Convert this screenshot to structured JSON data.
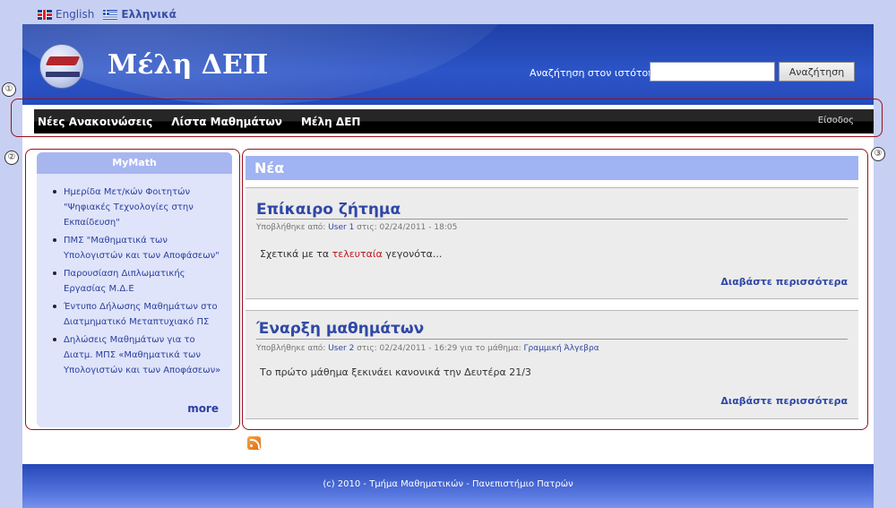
{
  "languages": [
    {
      "label": "English"
    },
    {
      "label": "Ελληνικά"
    }
  ],
  "header": {
    "site_title": "Μέλη ΔΕΠ",
    "search_label": "Αναζήτηση στον ιστότοπο:",
    "search_value": "",
    "search_button": "Αναζήτηση"
  },
  "nav": {
    "items": [
      {
        "label": "Νέες Ανακοινώσεις"
      },
      {
        "label": "Λίστα Μαθημάτων"
      },
      {
        "label": "Μέλη ΔΕΠ"
      }
    ],
    "login": "Είσοδος"
  },
  "callouts": [
    "①",
    "②",
    "③"
  ],
  "sidebar": {
    "title": "MyMath",
    "items": [
      {
        "label": "Ημερίδα Μετ/κών Φοιτητών \"Ψηφιακές Τεχνολογίες στην Εκπαίδευση\""
      },
      {
        "label": "ΠΜΣ \"Μαθηματικά των Υπολογιστών και των Αποφάσεων\""
      },
      {
        "label": "Παρουσίαση Διπλωματικής Εργασίας Μ.Δ.Ε"
      },
      {
        "label": "Έντυπο Δήλωσης Μαθημάτων στο Διατμηματικό Μεταπτυχιακό ΠΣ"
      },
      {
        "label": "Δηλώσεις Μαθημάτων για το Διατμ. ΜΠΣ «Μαθηματικά των Υπολογιστών και των Αποφάσεων»"
      }
    ],
    "more": "more"
  },
  "news": {
    "title": "Νέα",
    "articles": [
      {
        "title": "Επίκαιρο ζήτημα",
        "meta_prefix": "Υποβλήθηκε από:",
        "author": "User 1",
        "meta_date": " στις: 02/24/2011 - 18:05",
        "meta_course_prefix": "",
        "course": "",
        "body_before": "Σχετικά με τα ",
        "body_highlight": "τελευταία",
        "body_after": " γεγονότα...",
        "read_more": "Διαβάστε περισσότερα"
      },
      {
        "title": "Έναρξη μαθημάτων",
        "meta_prefix": "Υποβλήθηκε από:",
        "author": "User 2",
        "meta_date": " στις: 02/24/2011 - 16:29",
        "meta_course_prefix": " για το μάθημα: ",
        "course": "Γραμμική Άλγεβρα",
        "body_before": "Το πρώτο μάθημα ξεκινάει κανονικά την Δευτέρα 21/3",
        "body_highlight": "",
        "body_after": "",
        "read_more": "Διαβάστε περισσότερα"
      }
    ]
  },
  "rss_icon": "rss-feed-icon",
  "footer": {
    "text": "(c) 2010 - Τμήμα Μαθηματικών - Πανεπιστήμιο Πατρών"
  }
}
